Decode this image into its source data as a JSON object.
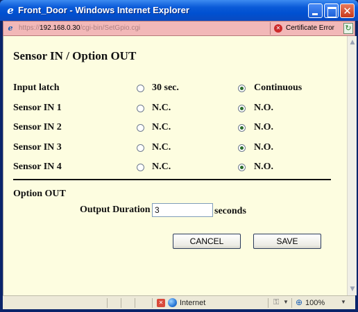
{
  "window": {
    "title": "Front_Door - Windows Internet Explorer"
  },
  "address_bar": {
    "scheme": "https://",
    "host": "192.168.0.30",
    "path": "/cgi-bin/SetGpio.cgi",
    "certificate_status": "Certificate Error"
  },
  "page": {
    "heading": "Sensor IN / Option OUT",
    "rows": [
      {
        "label": "Input latch",
        "options": [
          "30 sec.",
          "Continuous"
        ],
        "selected_index": 1
      },
      {
        "label": "Sensor IN 1",
        "options": [
          "N.C.",
          "N.O."
        ],
        "selected_index": 1
      },
      {
        "label": "Sensor IN 2",
        "options": [
          "N.C.",
          "N.O."
        ],
        "selected_index": 1
      },
      {
        "label": "Sensor IN 3",
        "options": [
          "N.C.",
          "N.O."
        ],
        "selected_index": 1
      },
      {
        "label": "Sensor IN 4",
        "options": [
          "N.C.",
          "N.O."
        ],
        "selected_index": 1
      }
    ],
    "option_out": {
      "title": "Option OUT",
      "output_duration_label": "Output Duration",
      "output_duration_value": "3",
      "unit": "seconds"
    },
    "buttons": {
      "cancel": "CANCEL",
      "save": "SAVE"
    }
  },
  "status_bar": {
    "zone": "Internet",
    "zoom": "100%"
  },
  "icons": {
    "title": "ie-logo-icon",
    "address": "ie-page-icon",
    "certificate": "certificate-error-icon",
    "refresh": "refresh-icon",
    "zone": "internet-globe-icon",
    "zoom": "zoom-icon"
  },
  "colors": {
    "page_background": "#fdfde0",
    "address_bar_error": "#f2b8b8",
    "titlebar": "#0a5ad8"
  }
}
